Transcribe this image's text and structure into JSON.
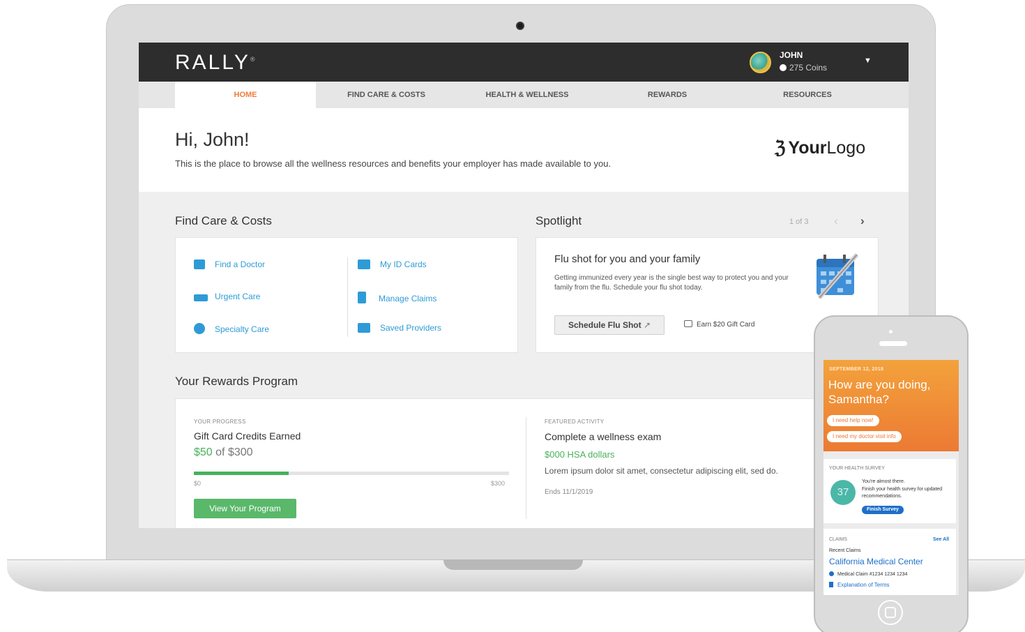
{
  "app": {
    "brand": "RALLY",
    "brand_mark": "®",
    "user": {
      "name": "JOHN",
      "coins": "275 Coins"
    }
  },
  "nav": {
    "tabs": [
      {
        "label": "HOME",
        "active": true
      },
      {
        "label": "FIND CARE & COSTS"
      },
      {
        "label": "HEALTH & WELLNESS"
      },
      {
        "label": "REWARDS"
      },
      {
        "label": "RESOURCES"
      }
    ]
  },
  "hero": {
    "greeting": "Hi, John!",
    "intro": "This is the place to browse all the wellness resources and benefits your employer has made available to you.",
    "logo_regular": "Your",
    "logo_bold": "Logo"
  },
  "find_care": {
    "title": "Find Care & Costs",
    "left_links": [
      "Find a Doctor",
      "Urgent Care",
      "Specialty Care"
    ],
    "right_links": [
      "My ID Cards",
      "Manage Claims",
      "Saved Providers"
    ],
    "icons": [
      "medical-bag-icon",
      "ambulance-icon",
      "heart-circle-icon",
      "id-card-icon",
      "document-icon",
      "folder-plus-icon"
    ]
  },
  "spotlight": {
    "title": "Spotlight",
    "pager": "1 of 3",
    "card_title": "Flu shot for you and your family",
    "description": "Getting immunized every year is the single best way to protect you and your family from the flu. Schedule your flu shot today.",
    "button": "Schedule Flu Shot",
    "reward": "Earn $20 Gift Card"
  },
  "rewards": {
    "title": "Your Rewards Program",
    "progress_label": "YOUR PROGRESS",
    "progress_title": "Gift Card Credits Earned",
    "earned": "$50",
    "of_text": "of $300",
    "progress_fraction": 0.3,
    "range_min": "$0",
    "range_max": "$300",
    "button": "View Your Program",
    "featured_label": "FEATURED ACTIVITY",
    "activity_title": "Complete a wellness exam",
    "activity_reward": "$000 HSA dollars",
    "activity_desc": "Lorem ipsum dolor sit amet, consectetur adipiscing elit, sed do.",
    "activity_ends": "Ends 11/1/2019"
  },
  "phone": {
    "date": "SEPTEMBER 12, 2018",
    "question": "How are you doing, Samantha?",
    "pill_help": "I need help now!",
    "pill_doctor": "I need my doctor visit info",
    "survey_label": "YOUR HEALTH SURVEY",
    "survey_badge": "37",
    "survey_line1": "You're almost there.",
    "survey_line2": "Finish your health survey for updated recommendations.",
    "survey_button": "Finish Survey",
    "claims_label": "CLAIMS",
    "see_all": "See All",
    "recent_claims": "Recent Claims",
    "provider": "California Medical Center",
    "claim_number": "Medical Claim #1234 1234 1234",
    "explanation": "Explanation of Terms"
  },
  "colors": {
    "accent_orange": "#ef7d3a",
    "link_blue": "#2e9bd6",
    "success_green": "#47b25a",
    "topbar_dark": "#2d2d2d"
  }
}
